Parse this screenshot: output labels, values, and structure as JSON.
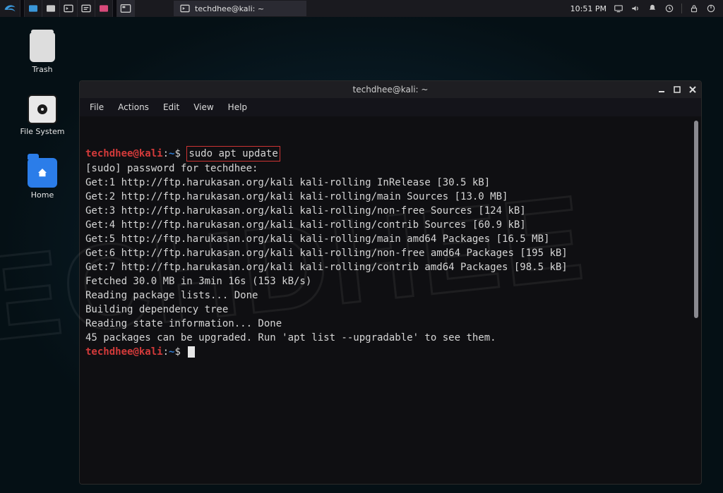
{
  "panel": {
    "time": "10:51 PM",
    "active_task_title": "techdhee@kali: ~"
  },
  "desktop": {
    "trash": "Trash",
    "filesystem": "File System",
    "home": "Home"
  },
  "terminal": {
    "title": "techdhee@kali: ~",
    "menu": {
      "file": "File",
      "actions": "Actions",
      "edit": "Edit",
      "view": "View",
      "help": "Help"
    },
    "prompt": {
      "user": "techdhee@kali",
      "path": "~",
      "symbol": "$"
    },
    "command": "sudo apt update",
    "output_lines": [
      "[sudo] password for techdhee:",
      "Get:1 http://ftp.harukasan.org/kali kali-rolling InRelease [30.5 kB]",
      "Get:2 http://ftp.harukasan.org/kali kali-rolling/main Sources [13.0 MB]",
      "Get:3 http://ftp.harukasan.org/kali kali-rolling/non-free Sources [124 kB]",
      "Get:4 http://ftp.harukasan.org/kali kali-rolling/contrib Sources [60.9 kB]",
      "Get:5 http://ftp.harukasan.org/kali kali-rolling/main amd64 Packages [16.5 MB]",
      "Get:6 http://ftp.harukasan.org/kali kali-rolling/non-free amd64 Packages [195 kB]",
      "Get:7 http://ftp.harukasan.org/kali kali-rolling/contrib amd64 Packages [98.5 kB]",
      "Fetched 30.0 MB in 3min 16s (153 kB/s)",
      "Reading package lists... Done",
      "Building dependency tree",
      "Reading state information... Done",
      "45 packages can be upgraded. Run 'apt list --upgradable' to see them."
    ]
  },
  "watermark": "TECHDHEE"
}
